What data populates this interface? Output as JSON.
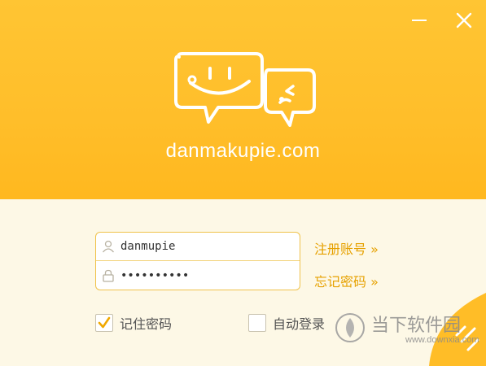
{
  "window": {
    "minimize_icon": "minus-icon",
    "close_icon": "close-icon"
  },
  "header": {
    "brand": "danmakupie.com",
    "logo_icon": "chat-bubbles-icon",
    "background_color": "#ffc533"
  },
  "login": {
    "username_value": "danmupie",
    "password_value": "••••••••••",
    "register_link": "注册账号 »",
    "forgot_link": "忘记密码 »",
    "remember_label": "记住密码",
    "remember_checked": true,
    "auto_login_label": "自动登录",
    "auto_login_checked": false,
    "accent_color": "#e6a100"
  },
  "watermark": {
    "name": "当下软件园",
    "url": "www.downxia.com"
  }
}
